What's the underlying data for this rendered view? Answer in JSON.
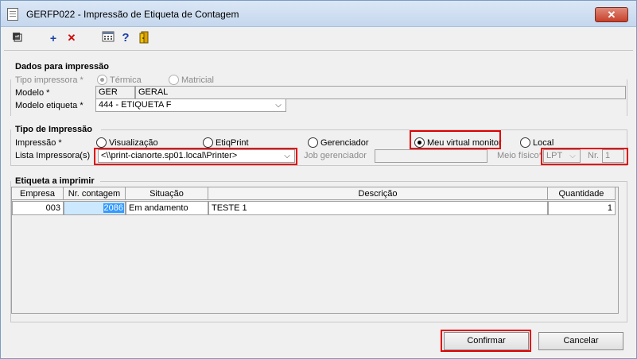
{
  "window": {
    "title": "GERFP022 - Impressão de Etiqueta de Contagem",
    "close_symbol": "✕"
  },
  "toolbar": {
    "icons": [
      "export-icon",
      "add-icon",
      "delete-icon",
      "calculator-icon",
      "help-icon",
      "exit-door-icon"
    ],
    "add_symbol": "+",
    "delete_symbol": "✕",
    "help_symbol": "?"
  },
  "dados": {
    "section_title": "Dados para impressão",
    "tipo_impressora_label": "Tipo impressora *",
    "termica_label": "Térmica",
    "matricial_label": "Matricial",
    "modelo_label": "Modelo *",
    "modelo_code": "GER",
    "modelo_name": "GERAL",
    "modelo_etiqueta_label": "Modelo etiqueta *",
    "modelo_etiqueta_value": "444 - ETIQUETA F"
  },
  "tipo": {
    "section_title": "Tipo de Impressão",
    "impressao_label": "Impressão *",
    "options": [
      "Visualização",
      "EtiqPrint",
      "Gerenciador",
      "Meu virtual monitor",
      "Local"
    ],
    "selected": "Meu virtual monitor",
    "lista_label": "Lista Impressora(s)",
    "lista_value": "<\\\\print-cianorte.sp01.local\\Printer>",
    "job_label": "Job gerenciador",
    "job_value": "",
    "meio_label": "Meio físico*",
    "meio_value": "LPT",
    "nr_label": "Nr.",
    "nr_value": "1"
  },
  "etiqueta": {
    "section_title": "Etiqueta a imprimir",
    "columns": [
      "Empresa",
      "Nr. contagem",
      "Situação",
      "Descrição",
      "Quantidade"
    ],
    "rows": [
      {
        "empresa": "003",
        "nr_contagem": "2086",
        "situacao": "Em andamento",
        "descricao": "TESTE 1",
        "quantidade": "1"
      }
    ]
  },
  "buttons": {
    "confirmar": "Confirmar",
    "cancelar": "Cancelar"
  },
  "colors": {
    "highlight_box": "#e00000",
    "selected_cell": "#3399ff",
    "selected_cell_bg": "#cce8ff"
  }
}
